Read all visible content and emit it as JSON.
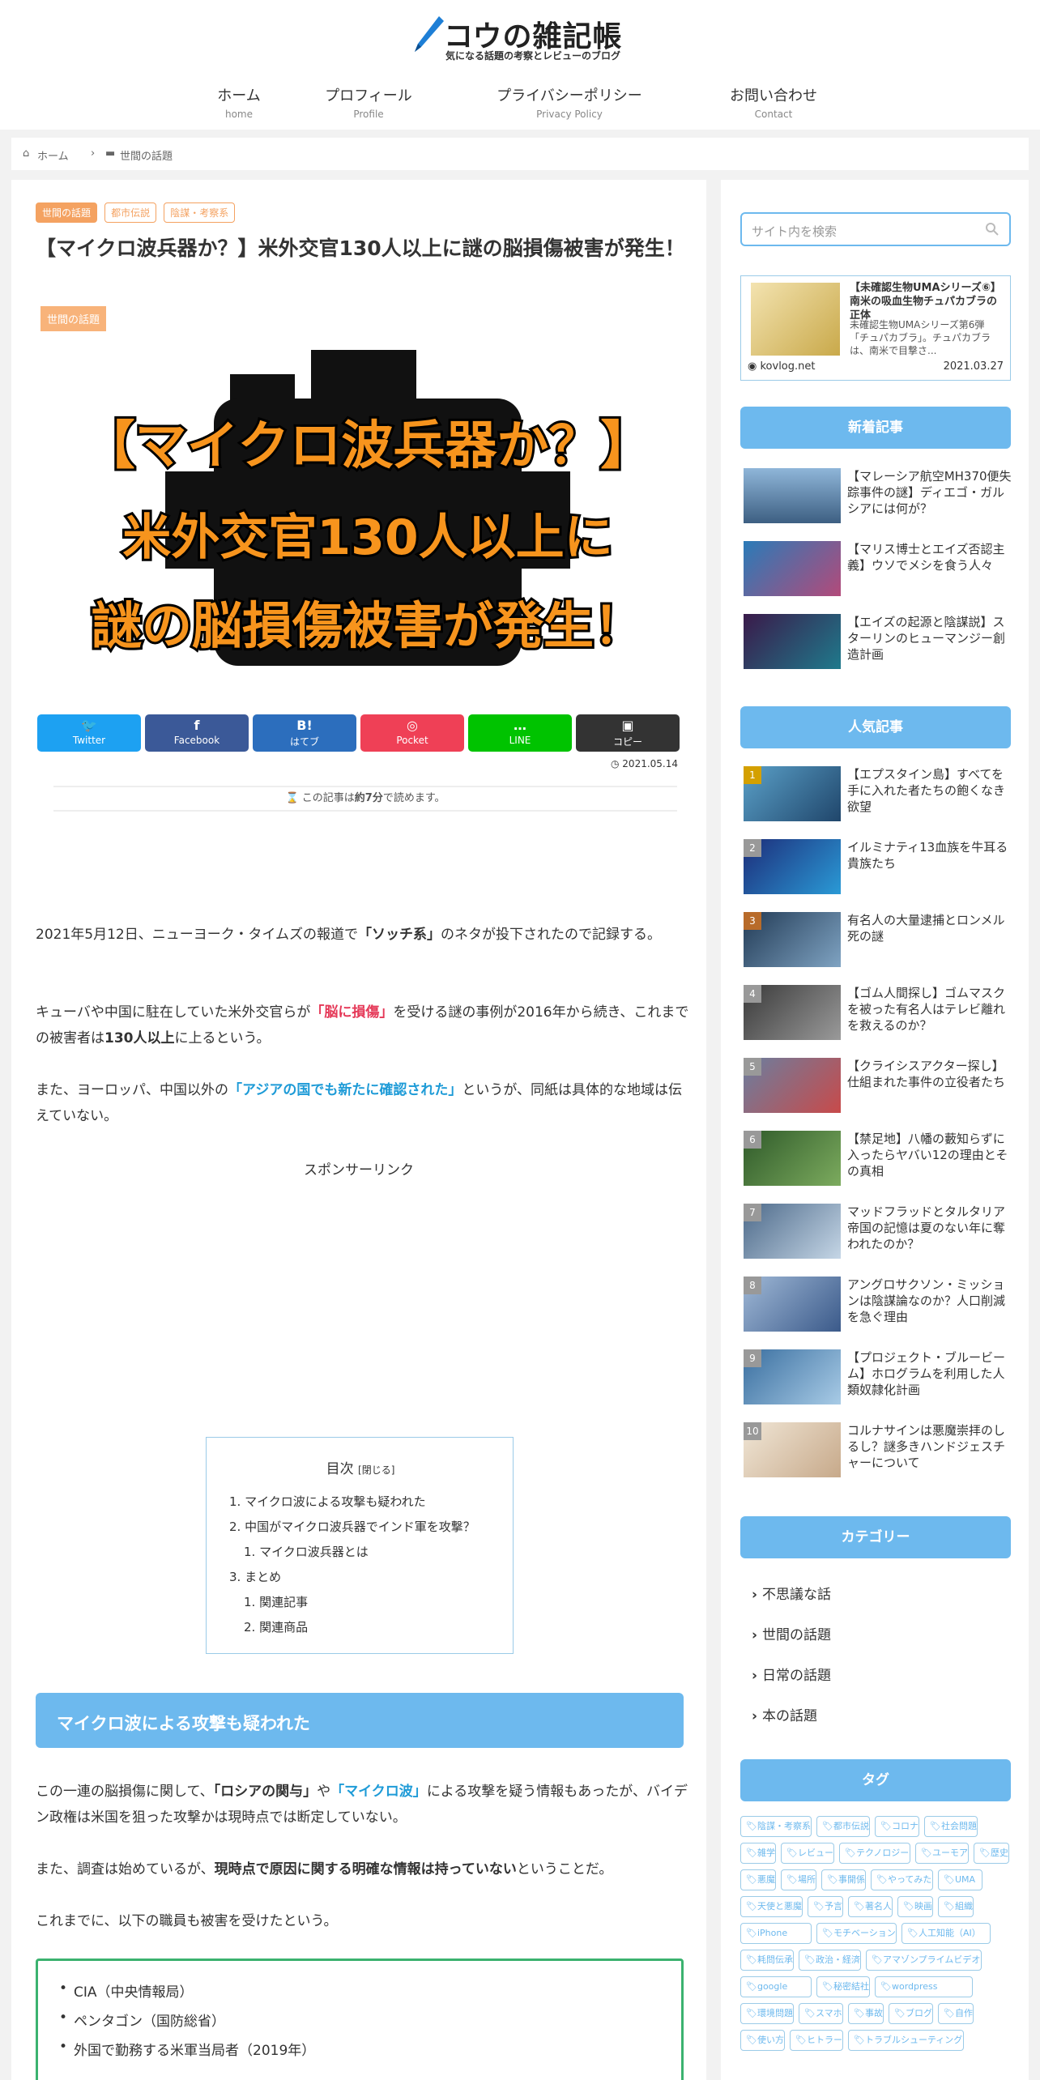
{
  "header": {
    "logo_title": "コウの雑記帳",
    "logo_sub": "気になる話題の考察とレビューのブログ",
    "nav": [
      {
        "jp": "ホーム",
        "en": "home"
      },
      {
        "jp": "プロフィール",
        "en": "Profile"
      },
      {
        "jp": "プライバシーポリシー",
        "en": "Privacy Policy"
      },
      {
        "jp": "お問い合わせ",
        "en": "Contact"
      }
    ]
  },
  "breadcrumb": {
    "home": "ホーム",
    "category": "世間の話題"
  },
  "article": {
    "tags": [
      "世間の話題",
      "都市伝説",
      "陰謀・考察系"
    ],
    "title": "【マイクロ波兵器か？】米外交官130人以上に謎の脳損傷被害が発生！",
    "category_badge": "世間の話題",
    "eyecatch_lines": [
      "【マイクロ波兵器か？】",
      "米外交官130人以上に",
      "謎の脳損傷被害が発生！"
    ],
    "share": [
      {
        "icon": "🐦",
        "label": "Twitter",
        "color": "#1da1f2"
      },
      {
        "icon": "f",
        "label": "Facebook",
        "color": "#3b5998"
      },
      {
        "icon": "B!",
        "label": "はてブ",
        "color": "#2c6ebd"
      },
      {
        "icon": "◎",
        "label": "Pocket",
        "color": "#ef4056"
      },
      {
        "icon": "…",
        "label": "LINE",
        "color": "#00c300"
      },
      {
        "icon": "▣",
        "label": "コピー",
        "color": "#333333"
      }
    ],
    "date": "2021.05.14",
    "readtime_pre": "この記事は",
    "readtime_val": "約7分",
    "readtime_post": "で読めます。",
    "p1_a": "2021年5月12日、ニューヨーク・タイムズの報道で",
    "p1_b": "「ソッチ系」",
    "p1_c": "のネタが投下されたので記録する。",
    "p2_a": "キューバや中国に駐在していた米外交官らが",
    "p2_b": "「脳に損傷」",
    "p2_c": "を受ける謎の事例が2016年から続き、これまでの被害者は",
    "p2_d": "130人以上",
    "p2_e": "に上るという。",
    "p3_a": "また、ヨーロッパ、中国以外の",
    "p3_b": "「アジアの国でも新たに確認された」",
    "p3_c": "というが、同紙は具体的な地域は伝えていない。",
    "sponsor": "スポンサーリンク",
    "toc": {
      "title": "目次",
      "toggle": "[閉じる]",
      "items": [
        "1. マイクロ波による攻撃も疑われた",
        "2. 中国がマイクロ波兵器でインド軍を攻撃？",
        "1. マイクロ波兵器とは",
        "3. まとめ",
        "1. 関連記事",
        "2. 関連商品"
      ]
    },
    "h2": "マイクロ波による攻撃も疑われた",
    "p4_a": "この一連の脳損傷に関して、",
    "p4_b": "「ロシアの関与」",
    "p4_c": "や",
    "p4_d": "「マイクロ波」",
    "p4_e": "による攻撃を疑う情報もあったが、バイデン政権は米国を狙った攻撃かは現時点では断定していない。",
    "p5_a": "また、調査は始めているが、",
    "p5_b": "現時点で原因に関する明確な情報は持っていない",
    "p5_c": "ということだ。",
    "p6": "これまでに、以下の職員も被害を受けたという。",
    "list": [
      "CIA（中央情報局）",
      "ペンタゴン（国防総省）",
      "外国で勤務する米軍当局者（2019年）"
    ]
  },
  "sidebar": {
    "search_placeholder": "サイト内を検索",
    "blogcard": {
      "title": "【未確認生物UMAシリーズ⑥】南米の吸血生物チュパカブラの正体",
      "desc": "未確認生物UMAシリーズ第6弾「チュパカブラ」。チュパカブラは、南米で目撃さ...",
      "site": "kovlog.net",
      "date": "2021.03.27"
    },
    "new_title": "新着記事",
    "new_posts": [
      "【マレーシア航空MH370便失踪事件の謎】ディエゴ・ガルシアには何が？",
      "【マリス博士とエイズ否認主義】ウソでメシを食う人々",
      "【エイズの起源と陰謀説】スターリンのヒューマンジー創造計画"
    ],
    "popular_title": "人気記事",
    "popular_posts": [
      "【エプスタイン島】すべてを手に入れた者たちの飽くなき欲望",
      "イルミナティ13血族を牛耳る貴族たち",
      "有名人の大量逮捕とロンメル死の謎",
      "【ゴム人間探し】ゴムマスクを被った有名人はテレビ離れを救えるのか？",
      "【クライシスアクター探し】仕組まれた事件の立役者たち",
      "【禁足地】八幡の藪知らずに入ったらヤバい12の理由とその真相",
      "マッドフラッドとタルタリア帝国の記憶は夏のない年に奪われたのか？",
      "アングロサクソン・ミッションは陰謀論なのか？人口削減を急ぐ理由",
      "【プロジェクト・ブルービーム】ホログラムを利用した人類奴隷化計画",
      "コルナサインは悪魔崇拝のしるし？謎多きハンドジェスチャーについて"
    ],
    "category_title": "カテゴリー",
    "categories": [
      "不思議な話",
      "世間の話題",
      "日常の話題",
      "本の話題"
    ],
    "tag_title": "タグ",
    "tags": [
      "陰謀・考察系",
      "都市伝説",
      "コロナ",
      "社会問題",
      "雑学",
      "レビュー",
      "テクノロジー",
      "ユーモア",
      "歴史",
      "悪魔",
      "場所",
      "事開係",
      "やってみた",
      "UMA",
      "天使と悪魔",
      "予言",
      "著名人",
      "映画",
      "組織",
      "iPhone",
      "モチベーション",
      "人工知能（AI）",
      "耗問伝承",
      "政治・経済",
      "アマゾンプライムビデオ",
      "google",
      "秘密結社",
      "wordpress",
      "環境問題",
      "スマホ",
      "事故",
      "ブログ",
      "自作",
      "使い方",
      "ヒトラー",
      "トラブルシューティング"
    ]
  }
}
